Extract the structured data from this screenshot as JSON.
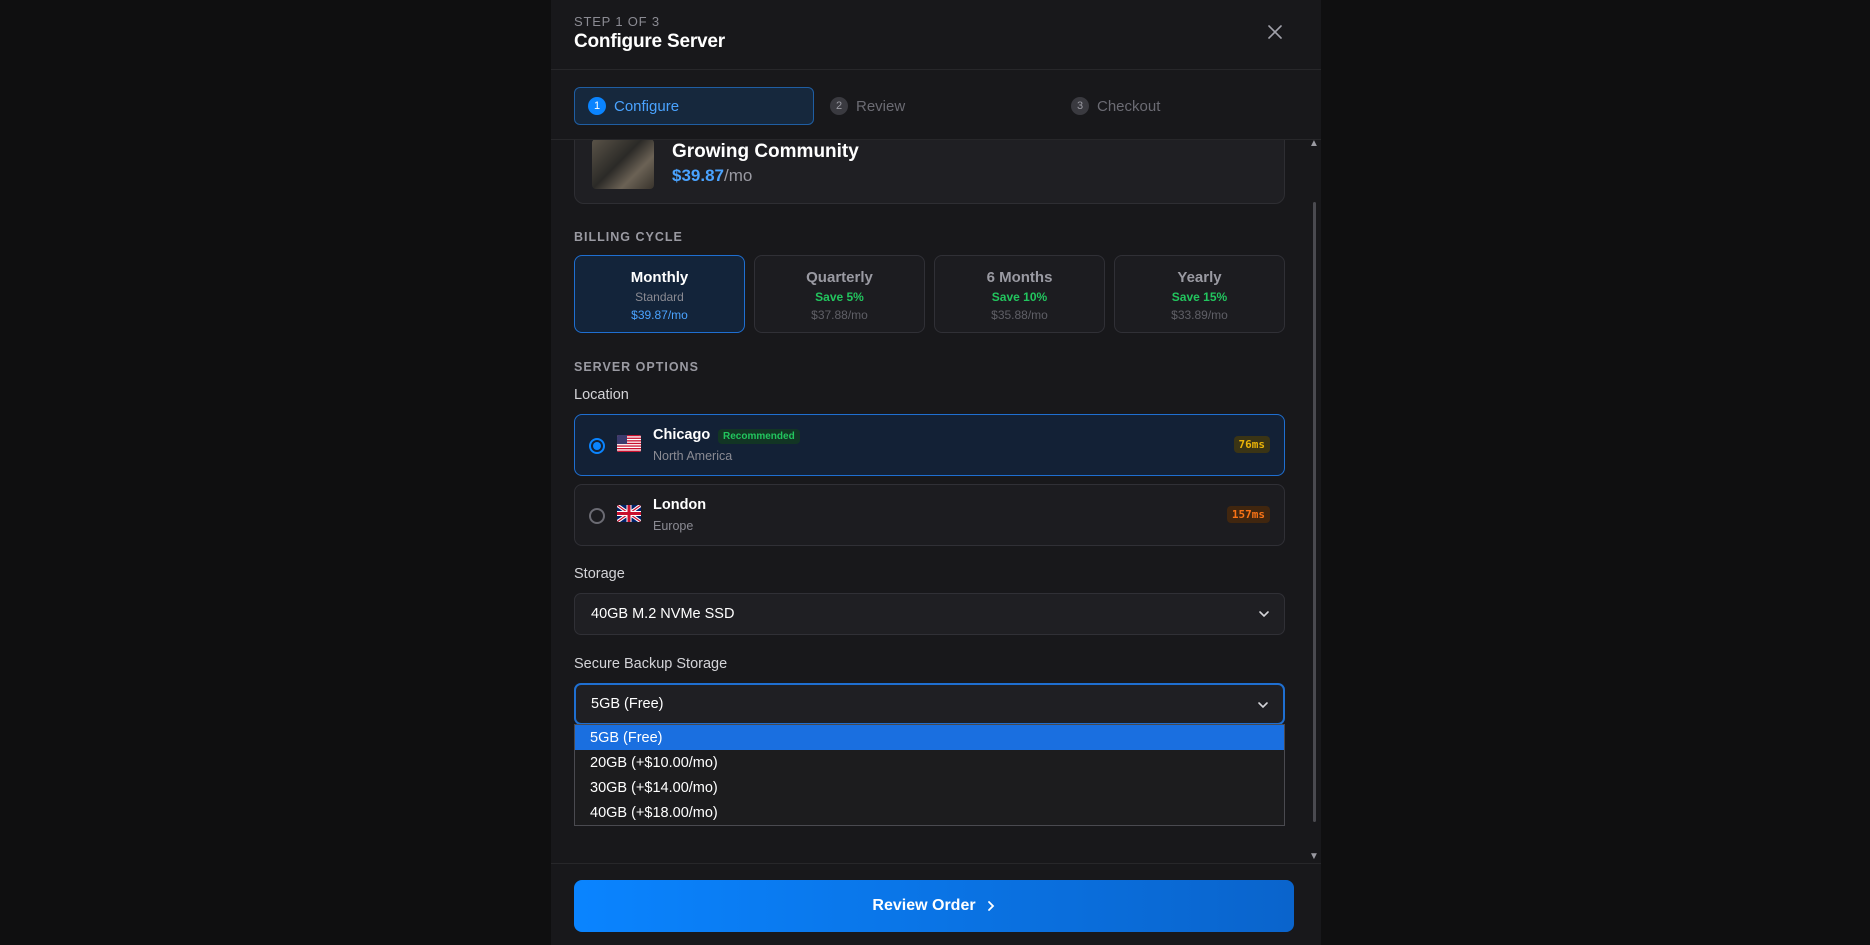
{
  "header": {
    "step_label": "STEP 1 OF 3",
    "title": "Configure Server"
  },
  "stepper": [
    {
      "num": "1",
      "label": "Configure"
    },
    {
      "num": "2",
      "label": "Review"
    },
    {
      "num": "3",
      "label": "Checkout"
    }
  ],
  "product": {
    "name": "Growing Community",
    "price": "$39.87",
    "period": "/mo"
  },
  "billing": {
    "label": "BILLING CYCLE",
    "options": [
      {
        "name": "Monthly",
        "sub": "Standard",
        "price": "$39.87/mo"
      },
      {
        "name": "Quarterly",
        "sub": "Save 5%",
        "price": "$37.88/mo"
      },
      {
        "name": "6 Months",
        "sub": "Save 10%",
        "price": "$35.88/mo"
      },
      {
        "name": "Yearly",
        "sub": "Save 15%",
        "price": "$33.89/mo"
      }
    ],
    "selected": "Monthly"
  },
  "server_options": {
    "label": "SERVER OPTIONS",
    "location_label": "Location",
    "locations": [
      {
        "name": "Chicago",
        "region": "North America",
        "badge": "Recommended",
        "ping": "76ms",
        "flag": "us-flag-icon"
      },
      {
        "name": "London",
        "region": "Europe",
        "ping": "157ms",
        "flag": "uk-flag-icon"
      }
    ],
    "storage_label": "Storage",
    "storage_value": "40GB M.2 NVMe SSD",
    "backup_label": "Secure Backup Storage",
    "backup_value": "5GB (Free)",
    "backup_options": [
      "5GB (Free)",
      "20GB (+$10.00/mo)",
      "30GB (+$14.00/mo)",
      "40GB (+$18.00/mo)"
    ]
  },
  "footer": {
    "review_label": "Review Order"
  },
  "colors": {
    "accent": "#0a84ff",
    "success": "#22c55e",
    "background": "#18181b"
  }
}
